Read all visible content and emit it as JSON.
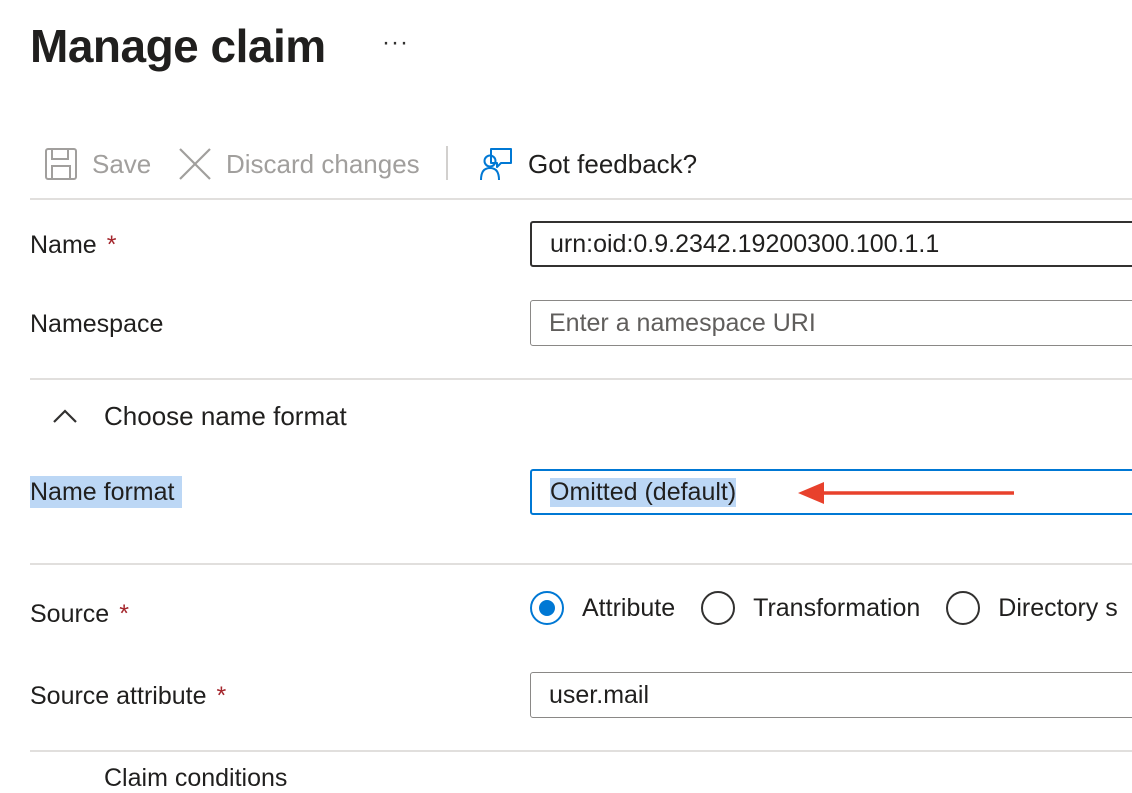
{
  "page": {
    "title": "Manage claim",
    "more_label": "···"
  },
  "toolbar": {
    "save_label": "Save",
    "discard_label": "Discard changes",
    "feedback_label": "Got feedback?"
  },
  "form": {
    "name_label": "Name",
    "name_value": "urn:oid:0.9.2342.19200300.100.1.1",
    "namespace_label": "Namespace",
    "namespace_placeholder": "Enter a namespace URI",
    "section_title": "Choose name format",
    "name_format_label": "Name format",
    "name_format_value": "Omitted (default)",
    "source_label": "Source",
    "source_options": [
      "Attribute",
      "Transformation",
      "Directory s"
    ],
    "source_selected": "Attribute",
    "source_attribute_label": "Source attribute",
    "source_attribute_value": "user.mail",
    "required_mark": "*",
    "next_section_partial": "Claim conditions"
  },
  "colors": {
    "accent": "#0078d4",
    "required": "#a4262c",
    "annotation_arrow": "#e8412c",
    "selection_highlight": "#bcd7f5"
  }
}
